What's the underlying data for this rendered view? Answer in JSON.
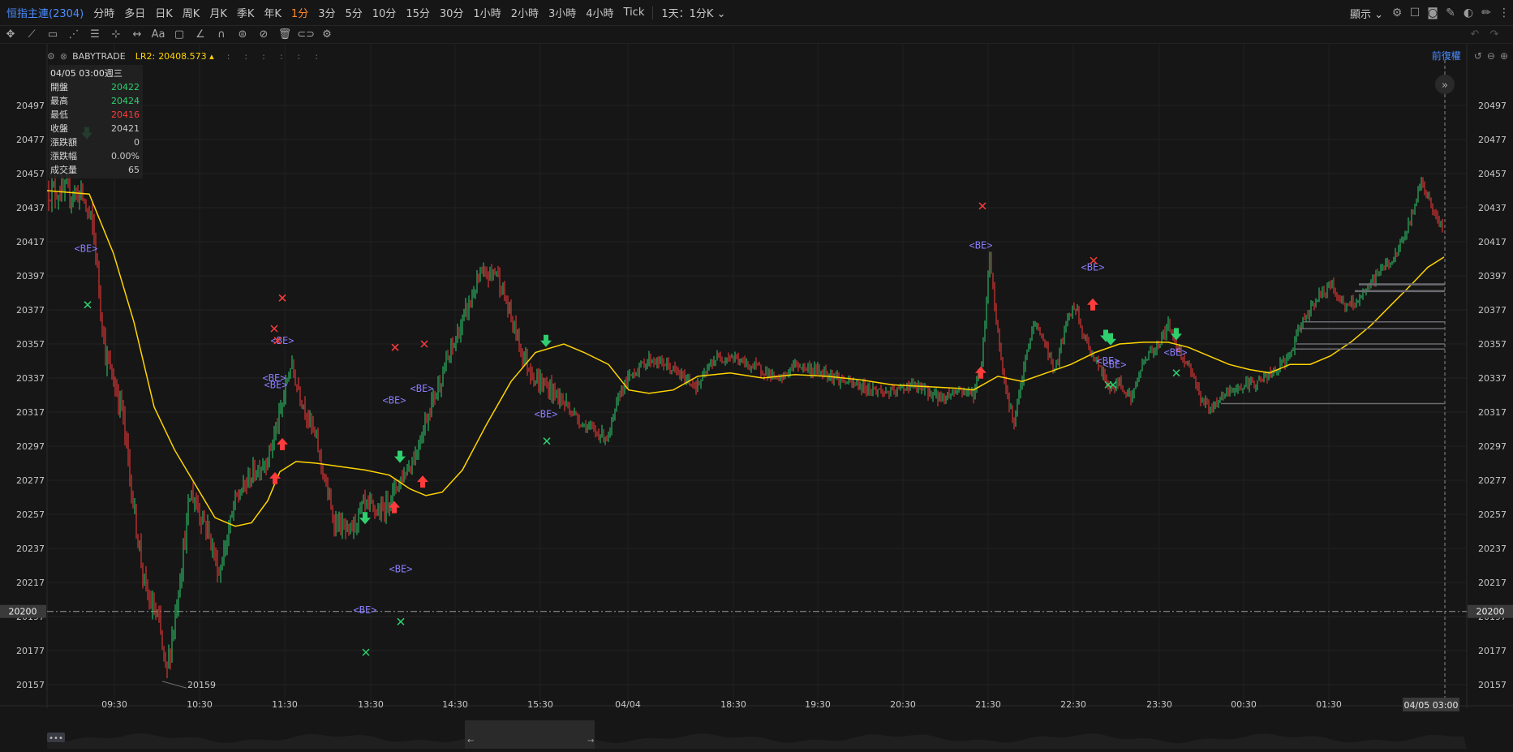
{
  "topbar": {
    "symbol": "恒指主連(2304)",
    "timeframes": [
      "分時",
      "多日",
      "日K",
      "周K",
      "月K",
      "季K",
      "年K",
      "1分",
      "3分",
      "5分",
      "10分",
      "15分",
      "30分",
      "1小時",
      "2小時",
      "3小時",
      "4小時",
      "Tick"
    ],
    "active_timeframe": "1分",
    "period_select": "1天：1分K ⌄",
    "display_label": "顯示 ⌄"
  },
  "legend": {
    "indicator": "BABYTRADE",
    "lr_label": "LR2:",
    "lr_value": "20408.573 ▴",
    "adjust_label": "前復權"
  },
  "ohlc": {
    "datetime": "04/05 03:00週三",
    "rows": [
      {
        "label": "開盤",
        "value": "20422",
        "color": "g"
      },
      {
        "label": "最高",
        "value": "20424",
        "color": "g"
      },
      {
        "label": "最低",
        "value": "20416",
        "color": "r"
      },
      {
        "label": "收盤",
        "value": "20421",
        "color": ""
      },
      {
        "label": "漲跌額",
        "value": "0",
        "color": ""
      },
      {
        "label": "漲跌幅",
        "value": "0.00%",
        "color": ""
      },
      {
        "label": "成交量",
        "value": "65",
        "color": ""
      }
    ]
  },
  "chart_data": {
    "type": "candlestick",
    "y_ticks": [
      20497,
      20477,
      20457,
      20437,
      20417,
      20397,
      20377,
      20357,
      20337,
      20317,
      20297,
      20277,
      20257,
      20237,
      20217,
      20197,
      20177,
      20157
    ],
    "ylim": [
      20148,
      20510
    ],
    "x_ticks": [
      "09:30",
      "10:30",
      "11:30",
      "13:30",
      "14:30",
      "15:30",
      "04/04",
      "18:30",
      "19:30",
      "20:30",
      "21:30",
      "22:30",
      "23:30",
      "00:30",
      "01:30"
    ],
    "current_time_label": "04/05 03:00",
    "reference_price": 20200,
    "reference_label": "20200",
    "low_annotation": "20159",
    "be_label": "<BE>",
    "colors": {
      "up": "#2fcf6e",
      "down": "#ff3b3b",
      "ma": "#ffd400",
      "be": "#8a7dff"
    }
  }
}
